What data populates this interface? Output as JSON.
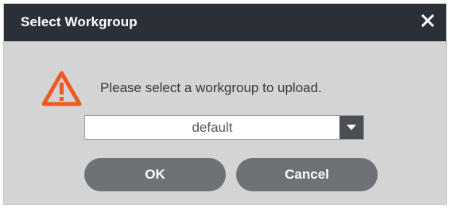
{
  "dialog": {
    "title": "Select Workgroup",
    "close_icon": "close-icon",
    "warning_icon": "warning-triangle-icon",
    "message": "Please select a workgroup to upload.",
    "workgroup_select": {
      "value": "default",
      "arrow_icon": "caret-down-icon"
    },
    "buttons": {
      "ok_label": "OK",
      "cancel_label": "Cancel"
    }
  },
  "colors": {
    "titlebar": "#2a2f38",
    "body": "#d4d4d4",
    "warning": "#ef5a24",
    "button": "#6e7276",
    "dropdown_arrow_bg": "#4b4f55"
  }
}
